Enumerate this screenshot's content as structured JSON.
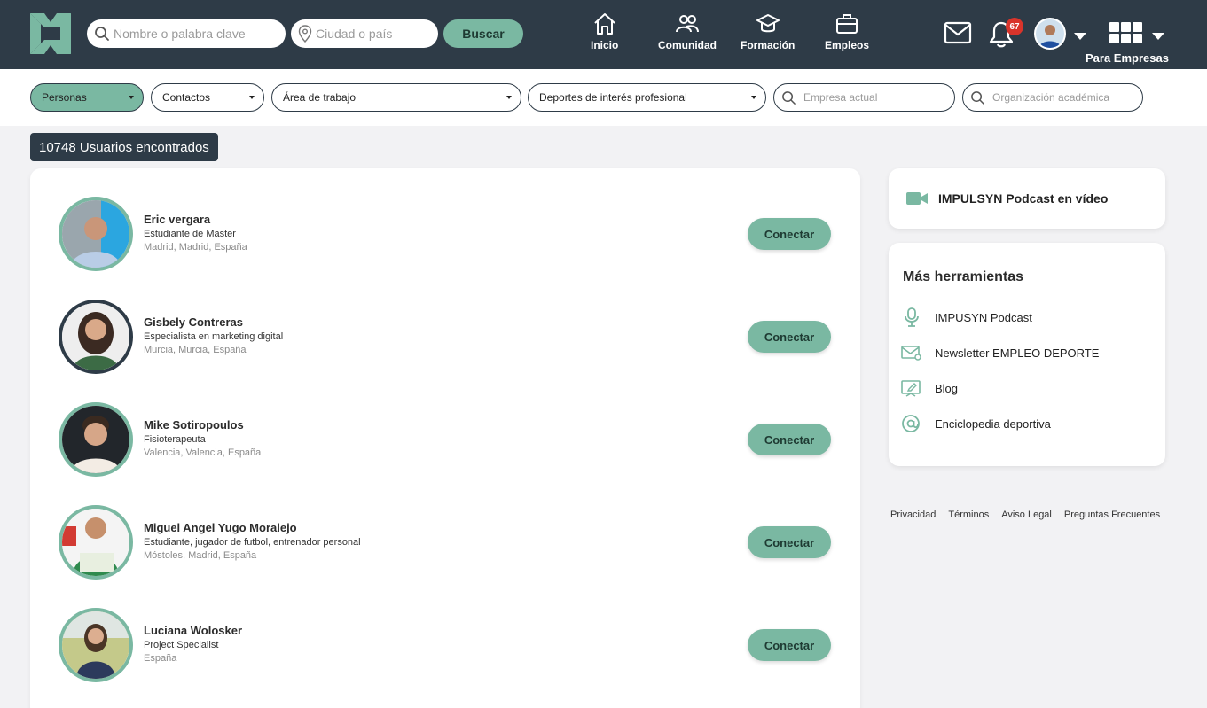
{
  "header": {
    "search_name_placeholder": "Nombre o palabra clave",
    "search_city_placeholder": "Ciudad o país",
    "search_button": "Buscar",
    "nav": [
      {
        "label": "Inicio",
        "icon": "home-icon"
      },
      {
        "label": "Comunidad",
        "icon": "community-icon"
      },
      {
        "label": "Formación",
        "icon": "graduation-cap-icon"
      },
      {
        "label": "Empleos",
        "icon": "briefcase-icon"
      }
    ],
    "notification_count": "67",
    "para_empresas": "Para Empresas"
  },
  "filters": {
    "personas": "Personas",
    "contactos": "Contactos",
    "area": "Área de trabajo",
    "deportes": "Deportes de interés profesional",
    "empresa_placeholder": "Empresa actual",
    "organizacion_placeholder": "Organización académica"
  },
  "results": {
    "count_label": "10748 Usuarios encontrados",
    "connect_label": "Conectar",
    "users": [
      {
        "name": "Eric vergara",
        "role": "Estudiante de Master",
        "location": "Madrid, Madrid, España"
      },
      {
        "name": "Gisbely Contreras",
        "role": "Especialista en marketing digital",
        "location": "Murcia, Murcia, España"
      },
      {
        "name": "Mike Sotiropoulos",
        "role": "Fisioterapeuta",
        "location": "Valencia, Valencia, España"
      },
      {
        "name": "Miguel Angel Yugo Moralejo",
        "role": "Estudiante, jugador de futbol, entrenador personal",
        "location": "Móstoles, Madrid, España"
      },
      {
        "name": "Luciana Wolosker",
        "role": "Project Specialist",
        "location": "España"
      }
    ]
  },
  "sidebar": {
    "podcast_title": "IMPULSYN Podcast en vídeo",
    "tools_title": "Más herramientas",
    "tools": [
      {
        "label": "IMPUSYN Podcast",
        "icon": "microphone-icon"
      },
      {
        "label": "Newsletter EMPLEO DEPORTE",
        "icon": "mail-icon"
      },
      {
        "label": "Blog",
        "icon": "blog-icon"
      },
      {
        "label": "Enciclopedia deportiva",
        "icon": "at-icon"
      }
    ],
    "footer": [
      "Privacidad",
      "Términos",
      "Aviso Legal",
      "Preguntas Frecuentes"
    ]
  },
  "colors": {
    "topbar": "#2e3b47",
    "accent": "#7ab8a2",
    "badge": "#d9342b"
  }
}
